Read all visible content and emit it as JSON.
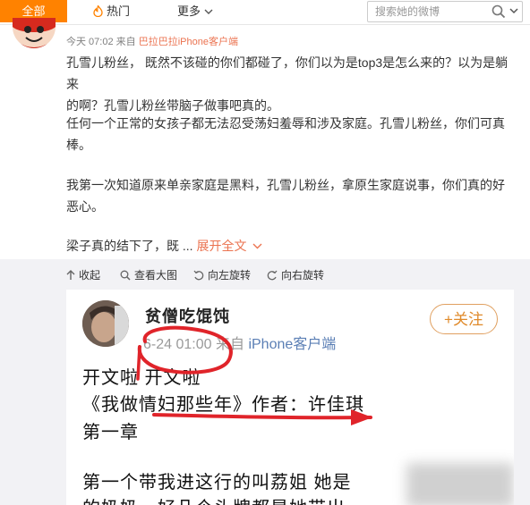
{
  "tabs": {
    "all": "全部",
    "hot": "热门",
    "more": "更多"
  },
  "search": {
    "placeholder": "搜索她的微博"
  },
  "post": {
    "time": "今天 07:02",
    "from_prefix": "来自",
    "source": "巴拉巴拉iPhone客户端",
    "paragraphs": [
      "孔雪儿粉丝， 既然不该碰的你们都碰了，你们以为是top3是怎么来的？以为是躺来",
      "的啊？孔雪儿粉丝带脑子做事吧真的。",
      "任何一个正常的女孩子都无法忍受荡妇羞辱和涉及家庭。孔雪儿粉丝，你们可真",
      "棒。",
      "我第一次知道原来单亲家庭是黑料，孔雪儿粉丝，拿原生家庭说事，你们真的好",
      "恶心。",
      "梁子真的结下了，既 ..."
    ],
    "expand_label": "展开全文"
  },
  "image_toolbar": {
    "collapse": "收起",
    "view_large": "查看大图",
    "rotate_left": "向左旋转",
    "rotate_right": "向右旋转"
  },
  "screenshot": {
    "username": "贫僧吃馄饨",
    "follow_label": "+关注",
    "time": "6-24 01:00",
    "from_prefix": "来自",
    "source": "iPhone客户端",
    "lines": [
      "开文啦 开文啦",
      "《我做情妇那些年》作者：许佳琪",
      "第一章",
      "第一个带我进这行的叫荔姐 她是",
      "的奶奶，好几个头牌都是她带出"
    ]
  },
  "colors": {
    "accent": "#ff8200",
    "link": "#eb7350",
    "annotation": "#e0242a"
  },
  "icons": [
    "flame-icon",
    "chevron-down-icon",
    "search-icon",
    "dropdown-arrow-icon",
    "collapse-icon",
    "magnify-icon",
    "rotate-left-icon",
    "rotate-right-icon"
  ]
}
